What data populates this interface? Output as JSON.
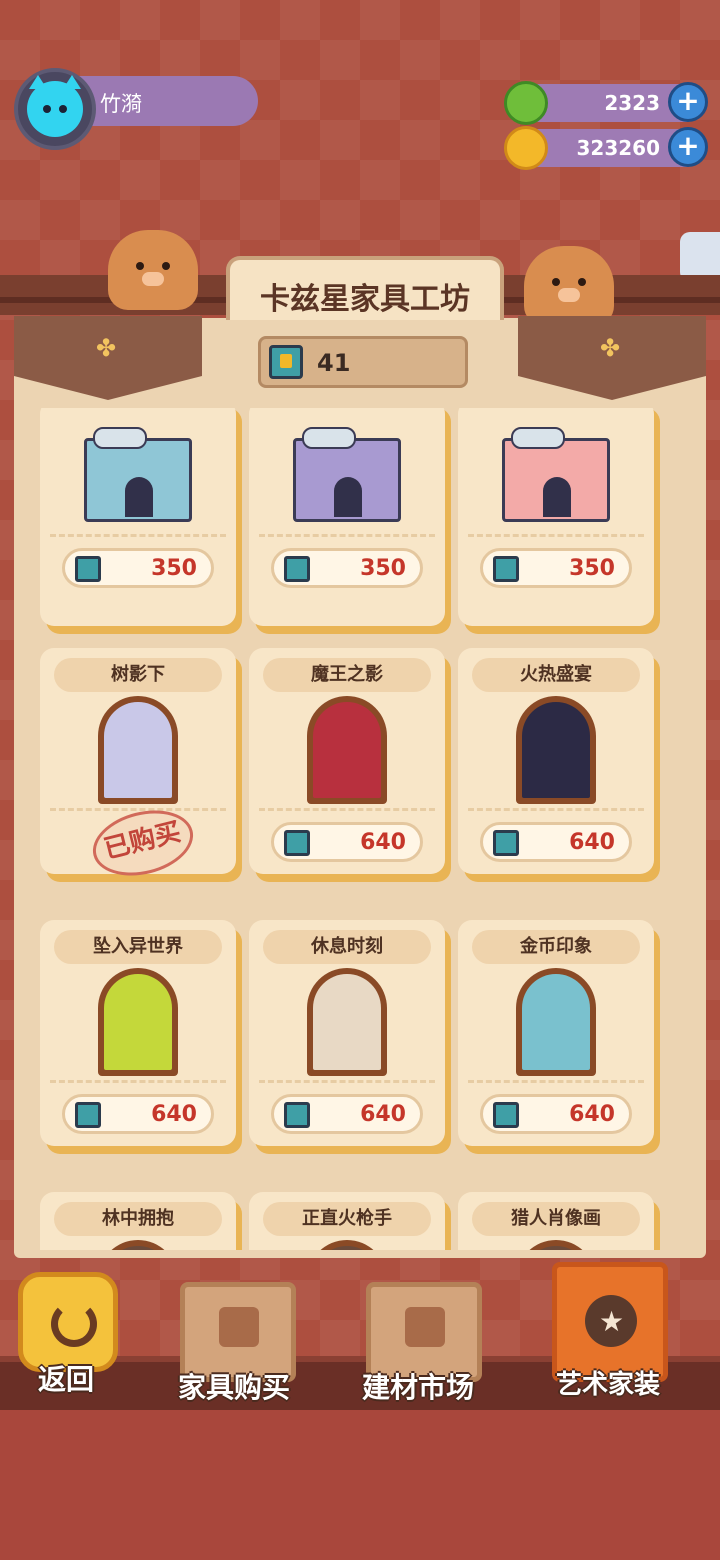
{
  "player": {
    "name": "竹漪"
  },
  "currency": {
    "gems": "2323",
    "coins": "323260"
  },
  "shop": {
    "title": "卡兹星家具工坊",
    "ticket_count": "41"
  },
  "row1": [
    {
      "price": "350",
      "color": "#8fc6d6"
    },
    {
      "price": "350",
      "color": "#a89ad1"
    },
    {
      "price": "350",
      "color": "#f3aaa8"
    }
  ],
  "row2": [
    {
      "title": "树影下",
      "status": "已购买",
      "art": "#c9c8e8"
    },
    {
      "title": "魔王之影",
      "price": "640",
      "art": "#b8303e"
    },
    {
      "title": "火热盛宴",
      "price": "640",
      "art": "#2c2a45"
    }
  ],
  "row3": [
    {
      "title": "坠入异世界",
      "price": "640",
      "art": "#c4d83a"
    },
    {
      "title": "休息时刻",
      "price": "640",
      "art": "#e8d9c5"
    },
    {
      "title": "金币印象",
      "price": "640",
      "art": "#7ac1ce"
    }
  ],
  "row4": [
    {
      "title": "林中拥抱"
    },
    {
      "title": "正直火枪手"
    },
    {
      "title": "猎人肖像画"
    }
  ],
  "nav": {
    "back": "返回",
    "furniture": "家具购买",
    "materials": "建材市场",
    "art": "艺术家装"
  }
}
